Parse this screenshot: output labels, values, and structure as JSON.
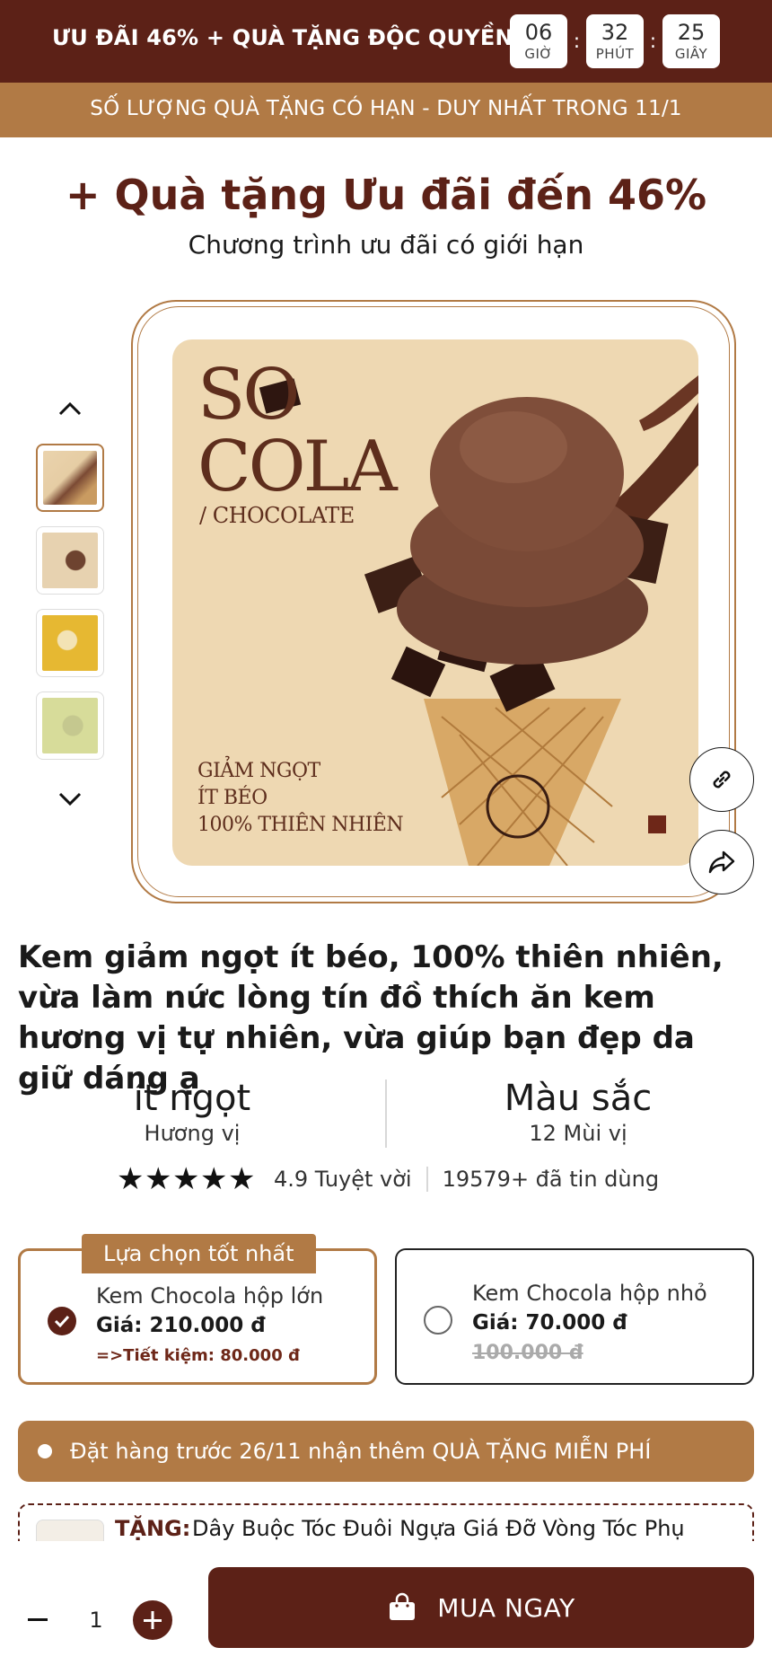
{
  "promo": {
    "text": "ƯU ĐÃI 46% + QUÀ TẶNG ĐỘC QUYỀN",
    "timer": [
      {
        "value": "06",
        "unit": "GIỜ"
      },
      {
        "value": "32",
        "unit": "PHÚT"
      },
      {
        "value": "25",
        "unit": "GIÂY"
      }
    ],
    "separator": ":"
  },
  "sub_bar": "SỐ LƯỢNG QUÀ TẶNG CÓ HẠN - DUY NHẤT TRONG 11/1",
  "headline": "+ Quà tặng Ưu đãi đến 46%",
  "subheadline": "Chương trình ưu đãi có giới hạn",
  "gallery": {
    "image_brand_line1": "SO",
    "image_brand_line2": "COLA",
    "image_sub": "/ CHOCOLATE",
    "image_claims": [
      "GIẢM NGỌT",
      "ÍT BÉO",
      "100% THIÊN NHIÊN"
    ],
    "up_icon": "chevron-up-icon",
    "down_icon": "chevron-down-icon",
    "link_icon": "link-icon",
    "share_icon": "share-icon",
    "thumb_colors": [
      "#e9cfa6",
      "#e7d2b0",
      "#e6b832",
      "#d7dc9a"
    ]
  },
  "product_title": "Kem giảm ngọt ít béo, 100% thiên nhiên, vừa làm nức lòng tín đồ thích ăn kem hương vị tự nhiên, vừa giúp bạn đẹp da giữ dáng ạ",
  "stats": {
    "left_big": "ít ngọt",
    "left_small": "Hương vị",
    "right_big": "Màu sắc",
    "right_small": "12 Mùi vị"
  },
  "rating": {
    "stars": 5,
    "score_text": "4.9 Tuyệt vời",
    "trust_text": "19579+ đã tin dùng"
  },
  "options": [
    {
      "badge": "Lựa chọn tốt nhất",
      "name": "Kem Chocola hộp lớn",
      "price": "Giá: 210.000 đ",
      "saving": "=>Tiết kiệm: 80.000 đ",
      "selected": true
    },
    {
      "name": "Kem Chocola hộp nhỏ",
      "price": "Giá: 70.000 đ",
      "old_price": "100.000 đ",
      "selected": false
    }
  ],
  "notice": "Đặt hàng trước 26/11 nhận thêm QUÀ TẶNG MIỄN PHÍ",
  "gift": {
    "label": "TẶNG:",
    "name": "Dây Buộc Tóc Đuôi Ngựa Giá Đỡ Vòng Tóc Phụ"
  },
  "bottom": {
    "quantity": "1",
    "buy_label": "MUA NGAY",
    "minus_icon": "minus-icon",
    "plus_icon": "plus-icon",
    "bag_icon": "shopping-bag-icon"
  },
  "colors": {
    "brand_dark": "#5c2117",
    "brand_accent": "#b17a45"
  }
}
